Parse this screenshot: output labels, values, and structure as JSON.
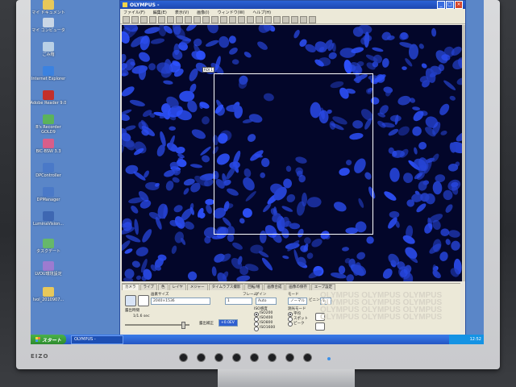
{
  "desktop": {
    "icons": [
      {
        "label": "マイ ドキュメント",
        "color": "#e8c85a"
      },
      {
        "label": "マイ コンピュータ",
        "color": "#c9d6e6"
      },
      {
        "label": "ごみ箱",
        "color": "#b9d0e6"
      },
      {
        "label": "Internet Explorer",
        "color": "#3b82e0"
      },
      {
        "label": "Adobe Reader 9.0",
        "color": "#c4302b"
      },
      {
        "label": "B's Recorder GOLD9",
        "color": "#5bb35b"
      },
      {
        "label": "BIC-BSW 3.3",
        "color": "#d85e8a"
      },
      {
        "label": "DPController",
        "color": "#4a79c8"
      },
      {
        "label": "DPManager",
        "color": "#4a79c8"
      },
      {
        "label": "LuminaVision...",
        "color": "#3e67b2"
      },
      {
        "label": "タスクデート",
        "color": "#66b86a"
      },
      {
        "label": "LVOU環境設定",
        "color": "#9c7bd0"
      },
      {
        "label": "lvol_2010907...",
        "color": "#e8c85a"
      }
    ]
  },
  "window": {
    "title": "OLYMPUS -",
    "menu": [
      "ファイル(F)",
      "編集(E)",
      "表示(V)",
      "画像(I)",
      "ウィンドウ(W)",
      "ヘルプ(H)"
    ],
    "roi_label": "ROI 1"
  },
  "panel": {
    "tabs": [
      "カメラ",
      "ライブ",
      "色",
      "レイヤ",
      "メジャー",
      "タイムラプス撮影",
      "回転/増",
      "画像合成",
      "画像の保存",
      "エーブ設定"
    ],
    "resolution_label": "画素サイズ",
    "resolution_value": "2040×1536",
    "frame_label": "1",
    "size_label": "フレーム",
    "exposure_label": "露出時間",
    "exposure_value": "1/1.6 sec",
    "correction_label": "露出補正",
    "correction_value": "+0.0EV",
    "gain_label": "ゲイン",
    "gain_value": "Auto",
    "iso_title": "ISO感度",
    "iso_options": [
      "ISO200",
      "ISO400",
      "ISO800",
      "ISO1600"
    ],
    "mode_title": "モード",
    "mode_value": "ノーマル",
    "binning_label": "ビニング",
    "binning_value": "1",
    "hist_title": "測光モード",
    "hist_options": [
      "平均",
      "スポット",
      "ピーク"
    ],
    "watermark": "OLYMPUS OLYMPUS OLYMPUS OLYMPUS OLYMPUS OLYMPUS OLYMPUS OLYMPUS OLYMPUS OLYMPUS OLYMPUS OLYMPUS"
  },
  "taskbar": {
    "start_label": "スタート",
    "task_label": "OLYMPUS -",
    "clock": "12:52"
  },
  "monitor": {
    "maker": "EIZO"
  }
}
